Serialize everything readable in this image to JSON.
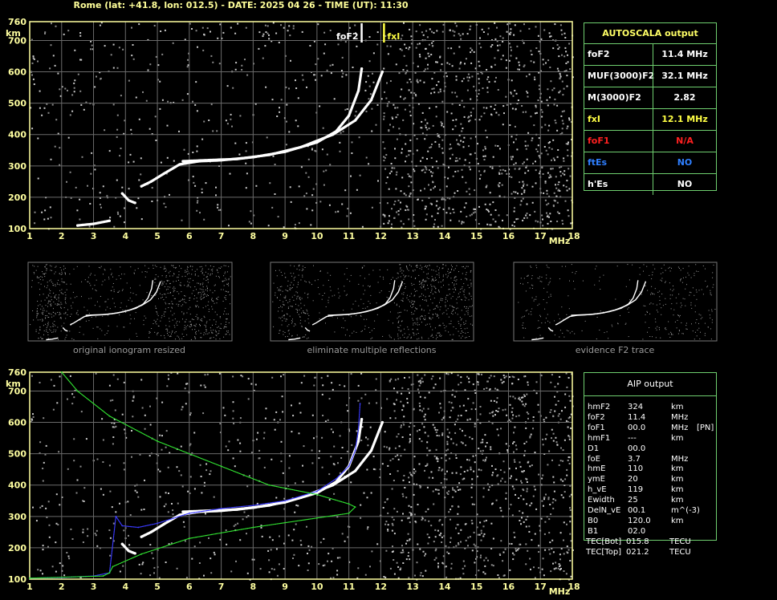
{
  "header": {
    "title": "Rome (lat: +41.8, lon: 012.5) - DATE: 2025 04 26 - TIME (UT): 11:30"
  },
  "autoscala": {
    "title": "AUTOSCALA output",
    "rows": [
      {
        "key": "foF2",
        "value": "11.4 MHz",
        "color": "#ffffff"
      },
      {
        "key": "MUF(3000)F2",
        "value": "32.1 MHz",
        "color": "#ffffff"
      },
      {
        "key": "M(3000)F2",
        "value": "2.82",
        "color": "#ffffff"
      },
      {
        "key": "fxI",
        "value": "12.1 MHz",
        "color": "#ffff44"
      },
      {
        "key": "foF1",
        "value": "N/A",
        "color": "#ff2020"
      },
      {
        "key": "ftEs",
        "value": "NO",
        "color": "#2f7fff"
      },
      {
        "key": "h'Es",
        "value": "NO",
        "color": "#ffffff"
      }
    ]
  },
  "aip": {
    "title": "AIP output",
    "rows": [
      {
        "name": "hmF2",
        "value": "324",
        "unit": "km",
        "extra": ""
      },
      {
        "name": "foF2",
        "value": "11.4",
        "unit": "MHz",
        "extra": ""
      },
      {
        "name": "foF1",
        "value": "00.0",
        "unit": "MHz",
        "extra": "[PN]"
      },
      {
        "name": "hmF1",
        "value": "---",
        "unit": "km",
        "extra": ""
      },
      {
        "name": "D1",
        "value": "00.0",
        "unit": "",
        "extra": ""
      },
      {
        "name": "foE",
        "value": "3.7",
        "unit": "MHz",
        "extra": ""
      },
      {
        "name": "hmE",
        "value": "110",
        "unit": "km",
        "extra": ""
      },
      {
        "name": "ymE",
        "value": "20",
        "unit": "km",
        "extra": ""
      },
      {
        "name": "h_vE",
        "value": "119",
        "unit": "km",
        "extra": ""
      },
      {
        "name": "Ewidth",
        "value": "25",
        "unit": "km",
        "extra": ""
      },
      {
        "name": "DelN_vE",
        "value": "00.1",
        "unit": "m^(-3)",
        "extra": ""
      },
      {
        "name": "B0",
        "value": "120.0",
        "unit": "km",
        "extra": ""
      },
      {
        "name": "B1",
        "value": "02.0",
        "unit": "",
        "extra": ""
      },
      {
        "name": "TEC[Bot]",
        "value": "015.8",
        "unit": "TECU",
        "extra": ""
      },
      {
        "name": "TEC[Top]",
        "value": "021.2",
        "unit": "TECU",
        "extra": ""
      }
    ]
  },
  "thumbnails": [
    {
      "label": "original ionogram resized"
    },
    {
      "label": "eliminate multiple reflections"
    },
    {
      "label": "evidence F2 trace"
    }
  ],
  "chart_data": [
    {
      "type": "scatter",
      "title": "",
      "xlabel": "MHz",
      "ylabel": "km",
      "xlim": [
        1,
        18
      ],
      "ylim": [
        100,
        760
      ],
      "x_ticks": [
        1,
        2,
        3,
        4,
        5,
        6,
        7,
        8,
        9,
        10,
        11,
        12,
        13,
        14,
        15,
        16,
        17,
        18
      ],
      "y_ticks": [
        100,
        200,
        300,
        400,
        500,
        600,
        700,
        760
      ],
      "annotations": [
        {
          "text": "foF2",
          "x": 11.4,
          "color": "#ffffff"
        },
        {
          "text": "fxI",
          "x": 12.1,
          "color": "#ffff44"
        }
      ],
      "series": [
        {
          "kind": "o-trace",
          "color": "#ffffff",
          "points": [
            [
              4.5,
              235
            ],
            [
              4.8,
              250
            ],
            [
              5.2,
              275
            ],
            [
              5.7,
              305
            ],
            [
              6.3,
              315
            ],
            [
              7,
              318
            ],
            [
              8,
              328
            ],
            [
              9,
              345
            ],
            [
              10,
              375
            ],
            [
              10.6,
              410
            ],
            [
              11,
              460
            ],
            [
              11.3,
              540
            ],
            [
              11.4,
              610
            ]
          ]
        },
        {
          "kind": "x-trace",
          "color": "#ffffff",
          "points": [
            [
              5.8,
              315
            ],
            [
              6.5,
              318
            ],
            [
              7.5,
              322
            ],
            [
              8.5,
              335
            ],
            [
              9.5,
              360
            ],
            [
              10.5,
              400
            ],
            [
              11.2,
              445
            ],
            [
              11.7,
              510
            ],
            [
              12.05,
              600
            ]
          ]
        },
        {
          "kind": "e-trace",
          "color": "#ffffff",
          "points": [
            [
              3.9,
              212
            ],
            [
              4.1,
              190
            ],
            [
              4.3,
              182
            ]
          ]
        },
        {
          "kind": "low-trace",
          "color": "#ffffff",
          "points": [
            [
              2.5,
              110
            ],
            [
              3.0,
              115
            ],
            [
              3.5,
              125
            ]
          ]
        }
      ]
    },
    {
      "type": "line",
      "title": "",
      "xlabel": "MHz",
      "ylabel": "km",
      "xlim": [
        1,
        18
      ],
      "ylim": [
        100,
        760
      ],
      "x_ticks": [
        1,
        2,
        3,
        4,
        5,
        6,
        7,
        8,
        9,
        10,
        11,
        12,
        13,
        14,
        15,
        16,
        17,
        18
      ],
      "y_ticks": [
        100,
        200,
        300,
        400,
        500,
        600,
        700,
        760
      ],
      "series": [
        {
          "kind": "o-trace",
          "color": "#ffffff",
          "points": [
            [
              4.5,
              235
            ],
            [
              4.8,
              250
            ],
            [
              5.2,
              275
            ],
            [
              5.7,
              305
            ],
            [
              6.3,
              315
            ],
            [
              7,
              318
            ],
            [
              8,
              328
            ],
            [
              9,
              345
            ],
            [
              10,
              375
            ],
            [
              10.6,
              410
            ],
            [
              11,
              460
            ],
            [
              11.3,
              540
            ],
            [
              11.4,
              610
            ]
          ]
        },
        {
          "kind": "x-trace",
          "color": "#ffffff",
          "points": [
            [
              5.8,
              315
            ],
            [
              6.5,
              318
            ],
            [
              7.5,
              322
            ],
            [
              8.5,
              335
            ],
            [
              9.5,
              360
            ],
            [
              10.5,
              400
            ],
            [
              11.2,
              445
            ],
            [
              11.7,
              510
            ],
            [
              12.05,
              600
            ]
          ]
        },
        {
          "kind": "e-trace",
          "color": "#ffffff",
          "points": [
            [
              3.9,
              212
            ],
            [
              4.1,
              190
            ],
            [
              4.3,
              182
            ]
          ]
        },
        {
          "kind": "modelled-trace",
          "color": "#3a3aff",
          "points": [
            [
              1,
              103
            ],
            [
              2,
              105
            ],
            [
              3,
              110
            ],
            [
              3.5,
              120
            ],
            [
              3.7,
              300
            ],
            [
              3.9,
              270
            ],
            [
              4.4,
              265
            ],
            [
              5,
              278
            ],
            [
              6,
              310
            ],
            [
              7,
              325
            ],
            [
              8,
              335
            ],
            [
              9,
              350
            ],
            [
              10,
              380
            ],
            [
              10.6,
              420
            ],
            [
              11,
              460
            ],
            [
              11.2,
              510
            ],
            [
              11.3,
              580
            ],
            [
              11.35,
              660
            ]
          ]
        },
        {
          "kind": "profile",
          "color": "#30e030",
          "points": [
            [
              2,
              760
            ],
            [
              2.5,
              700
            ],
            [
              3.5,
              620
            ],
            [
              5,
              540
            ],
            [
              7,
              460
            ],
            [
              8.5,
              400
            ],
            [
              10,
              370
            ],
            [
              11,
              340
            ],
            [
              11.2,
              330
            ],
            [
              11,
              310
            ],
            [
              10,
              295
            ],
            [
              8,
              265
            ],
            [
              6,
              230
            ],
            [
              4.5,
              180
            ],
            [
              3.6,
              140
            ],
            [
              3.5,
              120
            ],
            [
              3.3,
              110
            ],
            [
              1,
              103
            ]
          ]
        }
      ]
    }
  ]
}
